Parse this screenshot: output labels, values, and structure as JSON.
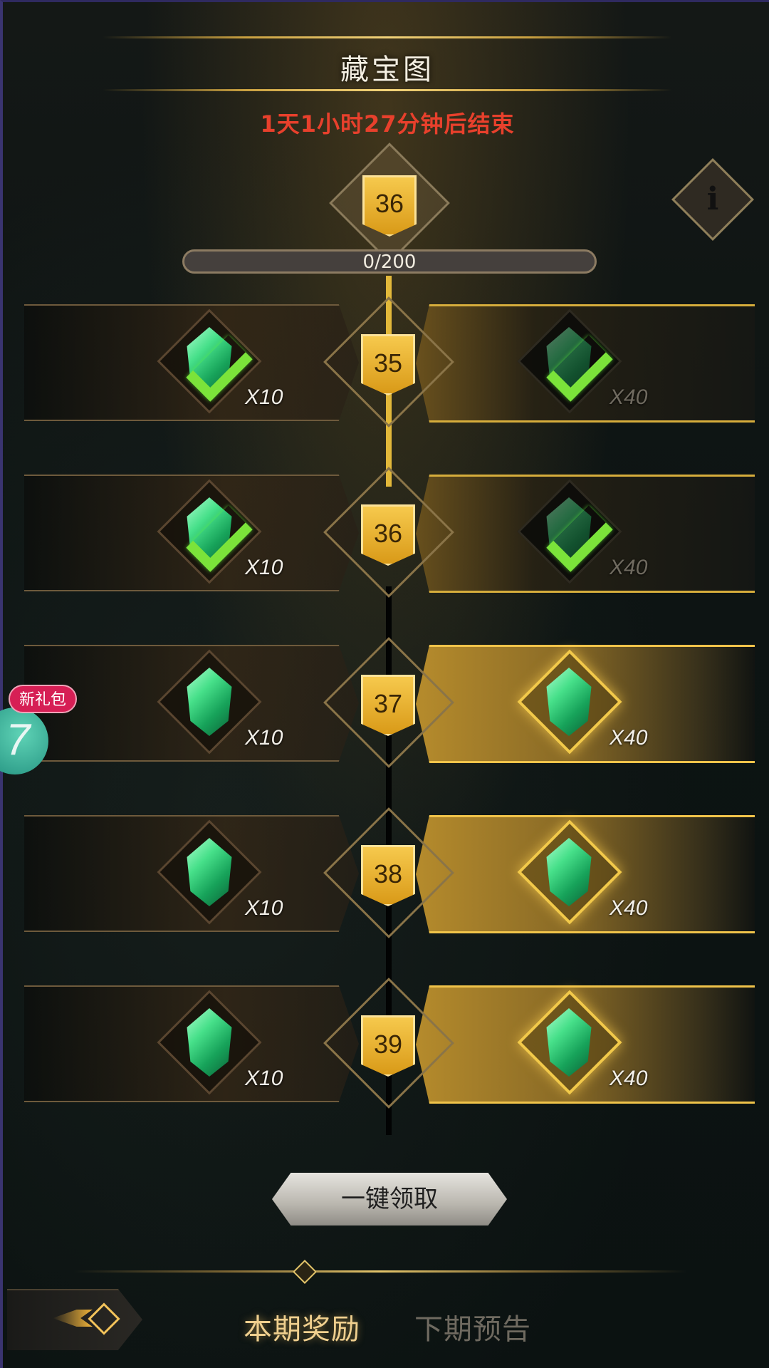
{
  "header": {
    "title": "藏宝图",
    "countdown": "1天1小时27分钟后结束"
  },
  "current_level": "36",
  "progress": {
    "text": "0/200",
    "fraction": 0.0
  },
  "icons": {
    "info": "info-icon",
    "gem": "green-gem-icon",
    "claimed": "check-icon",
    "back": "back-arrow-icon"
  },
  "rows": [
    {
      "level": "35",
      "free_qty": "X10",
      "premium_qty": "X40",
      "free_claimed": true,
      "premium_claimed": true
    },
    {
      "level": "36",
      "free_qty": "X10",
      "premium_qty": "X40",
      "free_claimed": true,
      "premium_claimed": true
    },
    {
      "level": "37",
      "free_qty": "X10",
      "premium_qty": "X40",
      "free_claimed": false,
      "premium_claimed": false
    },
    {
      "level": "38",
      "free_qty": "X10",
      "premium_qty": "X40",
      "free_claimed": false,
      "premium_claimed": false
    },
    {
      "level": "39",
      "free_qty": "X10",
      "premium_qty": "X40",
      "free_claimed": false,
      "premium_claimed": false
    }
  ],
  "claim_all": "一键领取",
  "tabs": [
    {
      "label": "本期奖励",
      "active": true
    },
    {
      "label": "下期预告",
      "active": false
    }
  ],
  "side_gift": {
    "badge": "新礼包",
    "digit": "7"
  },
  "colors": {
    "countdown": "#e8402c",
    "gold": "#e2b83a",
    "gem_green": "#47e08a",
    "check_green": "#7be33a",
    "gift_badge": "#d61f55"
  }
}
